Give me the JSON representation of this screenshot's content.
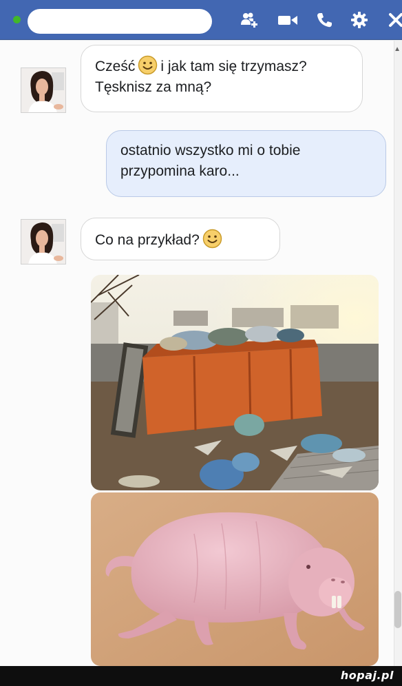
{
  "header": {
    "contact_name": "",
    "online_status_color": "#42b72a",
    "icons": [
      "add-friend-icon",
      "video-call-icon",
      "phone-call-icon",
      "gear-icon",
      "close-icon"
    ]
  },
  "messages": [
    {
      "from": "them",
      "text_before": "Cześć",
      "text_after": "i jak tam się trzymasz? Tęsknisz za mną?",
      "emoji": "smiley"
    },
    {
      "from": "me",
      "text": "ostatnio wszystko mi o tobie przypomina karo..."
    },
    {
      "from": "them",
      "text": "Co na przykład?",
      "emoji": "smiley"
    },
    {
      "from": "them",
      "type": "photo",
      "subject": "overflowing-dumpster"
    },
    {
      "from": "them",
      "type": "photo",
      "subject": "naked-mole-rat"
    }
  ],
  "watermark": "hopaj.pl"
}
